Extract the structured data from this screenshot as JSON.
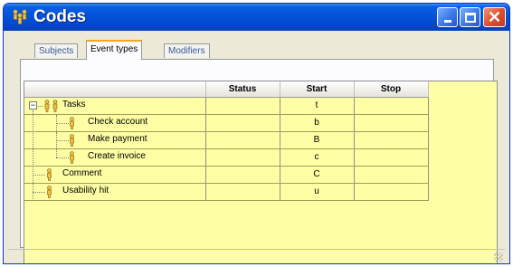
{
  "window": {
    "title": "Codes",
    "app_icon": "people-group-icon"
  },
  "tabs": [
    {
      "label": "Subjects",
      "active": false
    },
    {
      "label": "Event types",
      "active": true
    },
    {
      "label": "Modifiers",
      "active": false
    }
  ],
  "grid": {
    "columns": [
      "",
      "Status",
      "Start",
      "Stop"
    ],
    "rows": [
      {
        "name": "Tasks",
        "status": "",
        "start": "t",
        "stop": "",
        "level": 0,
        "expanded": true,
        "icon": "group-person-icon"
      },
      {
        "name": "Check account",
        "status": "",
        "start": "b",
        "stop": "",
        "level": 1,
        "icon": "person-icon"
      },
      {
        "name": "Make payment",
        "status": "",
        "start": "B",
        "stop": "",
        "level": 1,
        "icon": "person-icon"
      },
      {
        "name": "Create invoice",
        "status": "",
        "start": "c",
        "stop": "",
        "level": 1,
        "icon": "person-icon"
      },
      {
        "name": "Comment",
        "status": "",
        "start": "C",
        "stop": "",
        "level": 0,
        "icon": "person-icon"
      },
      {
        "name": "Usability hit",
        "status": "",
        "start": "u",
        "stop": "",
        "level": 0,
        "icon": "person-icon"
      }
    ]
  },
  "colors": {
    "grid_background": "#fefea4",
    "title_bar": "#0454d9",
    "close_button": "#e0502e",
    "person_icon": "#d6a93a"
  }
}
